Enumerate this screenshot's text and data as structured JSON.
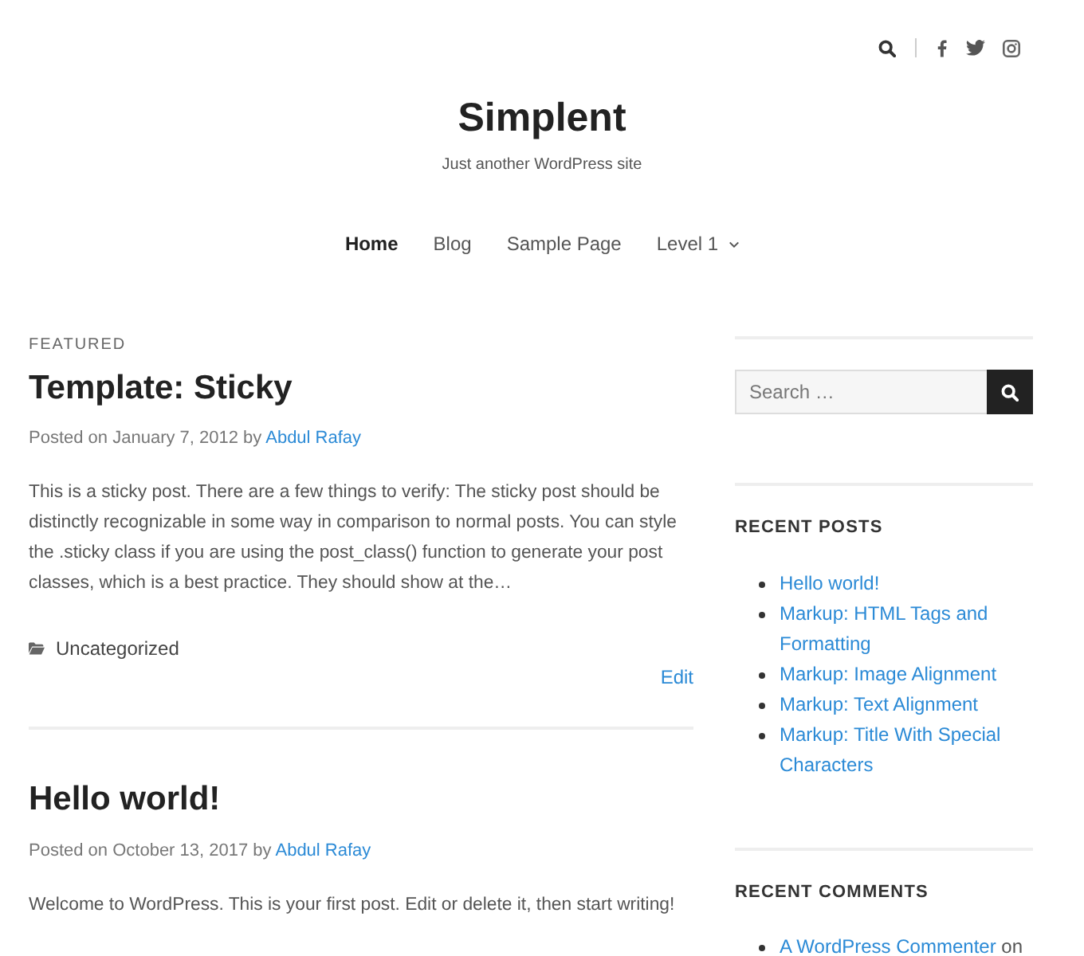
{
  "site": {
    "title": "Simplent",
    "tagline": "Just another WordPress site"
  },
  "nav": [
    {
      "label": "Home",
      "selected": true,
      "submenu": false
    },
    {
      "label": "Blog",
      "selected": false,
      "submenu": false
    },
    {
      "label": "Sample Page",
      "selected": false,
      "submenu": false
    },
    {
      "label": "Level 1",
      "selected": false,
      "submenu": true
    }
  ],
  "posts": [
    {
      "label": "FEATURED",
      "title": "Template: Sticky",
      "posted_on": "Posted on",
      "date": "January 7, 2012",
      "by": "by",
      "author": "Abdul Rafay",
      "excerpt": "This is a sticky post. There are a few things to verify: The sticky post should be distinctly recognizable in some way in comparison to normal posts. You can style the .sticky class if you are using the post_class() function to generate your post classes, which is a best practice. They should show at the…",
      "category": "Uncategorized",
      "edit": "Edit"
    },
    {
      "title": "Hello world!",
      "posted_on": "Posted on",
      "date": "October 13, 2017",
      "by": "by",
      "author": "Abdul Rafay",
      "excerpt": "Welcome to WordPress. This is your first post. Edit or delete it, then start writing!"
    }
  ],
  "sidebar": {
    "search": {
      "placeholder": "Search …"
    },
    "widgets": [
      {
        "title": "RECENT POSTS",
        "items": [
          {
            "link": "Hello world!"
          },
          {
            "link": "Markup: HTML Tags and Formatting"
          },
          {
            "link": "Markup: Image Alignment"
          },
          {
            "link": "Markup: Text Alignment"
          },
          {
            "link": "Markup: Title With Special Characters"
          }
        ]
      },
      {
        "title": "RECENT COMMENTS",
        "items": [
          {
            "link": "A WordPress Commenter",
            "text": "on"
          }
        ]
      }
    ]
  }
}
